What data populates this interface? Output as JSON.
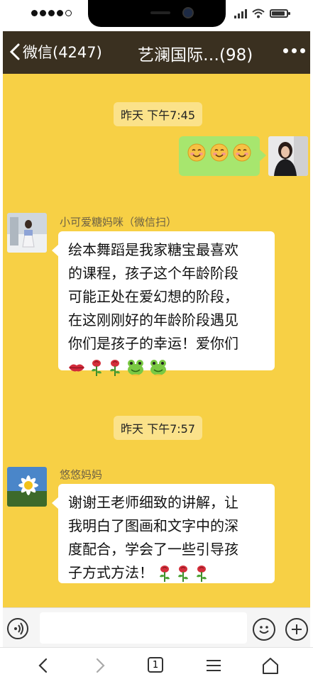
{
  "header": {
    "back_label": "微信(4247)",
    "title": "艺澜国际…(98)"
  },
  "messages": {
    "ts1": "昨天 下午7:45",
    "self_emoji": [
      "smile-emoji",
      "smile-emoji",
      "smile-emoji"
    ],
    "msg1": {
      "sender": "小可爱糖妈咪（微信扫）",
      "lines": [
        "绘本舞蹈是我家糖宝最喜欢",
        "的课程，孩子这个年龄阶段",
        "可能正处在爱幻想的阶段，",
        "在这刚刚好的年龄阶段遇见",
        "你们是孩子的幸运！爱你们"
      ],
      "emoji": [
        "lips-emoji",
        "rose-emoji",
        "rose-emoji",
        "frog-emoji",
        "frog-emoji"
      ]
    },
    "ts2": "昨天 下午7:57",
    "msg2": {
      "sender": "悠悠妈妈",
      "lines": [
        "谢谢王老师细致的讲解，让",
        "我明白了图画和文字中的深",
        "度配合，学会了一些引导孩",
        "子方式方法！"
      ],
      "emoji": [
        "rose-emoji",
        "rose-emoji",
        "rose-emoji"
      ]
    }
  },
  "input": {
    "placeholder": ""
  },
  "browser": {
    "tab_count": "1"
  },
  "colors": {
    "chat_bg": "#f7d045",
    "header_bg": "#3a3020",
    "self_bubble": "#a7e66e"
  }
}
